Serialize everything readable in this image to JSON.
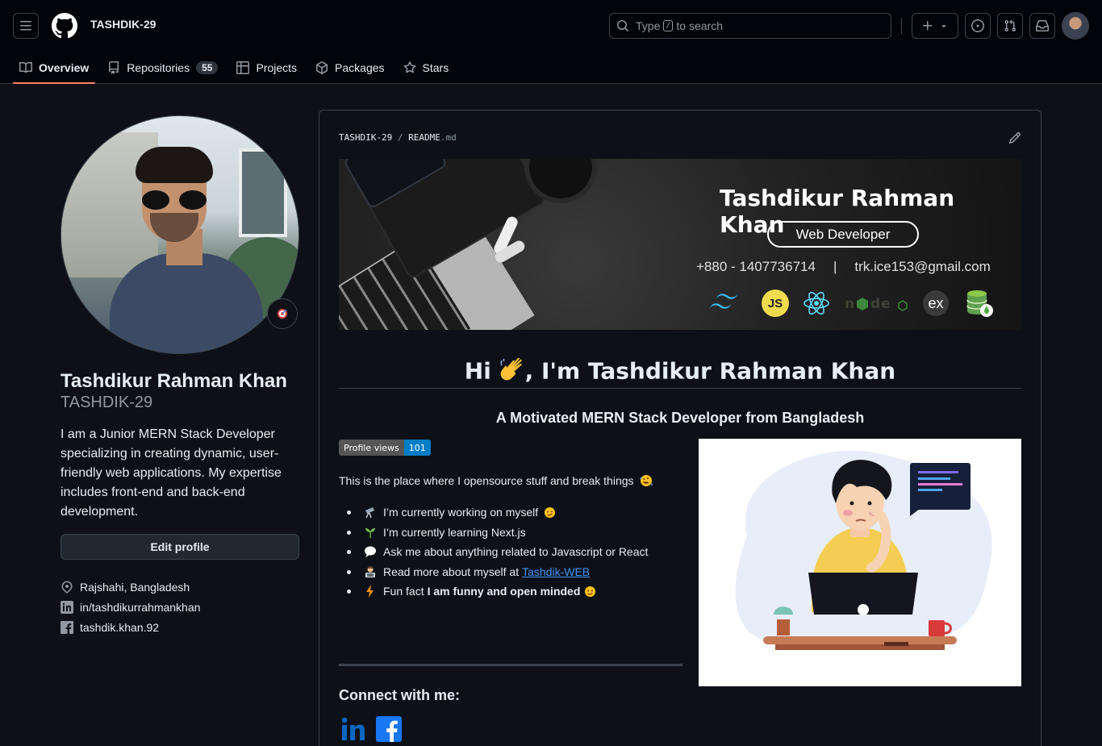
{
  "header": {
    "username": "TASHDIK-29",
    "search": {
      "prefix": "Type",
      "key": "/",
      "suffix": "to search"
    }
  },
  "nav": {
    "tabs": [
      {
        "label": "Overview",
        "icon": "book-icon",
        "active": true
      },
      {
        "label": "Repositories",
        "icon": "repo-icon",
        "count": "55"
      },
      {
        "label": "Projects",
        "icon": "table-icon"
      },
      {
        "label": "Packages",
        "icon": "package-icon"
      },
      {
        "label": "Stars",
        "icon": "star-icon"
      }
    ]
  },
  "profile": {
    "name": "Tashdikur Rahman Khan",
    "login": "TASHDIK-29",
    "bio": "I am a Junior MERN Stack Developer specializing in creating dynamic, user-friendly web applications. My expertise includes front-end and back-end development.",
    "edit_label": "Edit profile",
    "location": "Rajshahi, Bangladesh",
    "linkedin": "in/tashdikurrahmankhan",
    "facebook": "tashdik.khan.92"
  },
  "readme": {
    "owner": "TASHDIK-29",
    "file": "README",
    "ext": ".md",
    "banner": {
      "name": "Tashdikur Rahman Khan",
      "role": "Web Developer",
      "phone": "+880 - 1407736714",
      "separator": "|",
      "email": "trk.ice153@gmail.com",
      "tech_icons": [
        "tailwind-icon",
        "javascript-icon",
        "react-icon",
        "nodejs-icon",
        "express-icon",
        "mongodb-icon"
      ],
      "js_label": "JS",
      "ex_label": "ex"
    },
    "heading_pre": "Hi",
    "heading_post": ", I'm Tashdikur Rahman Khan",
    "subtitle": "A Motivated MERN Stack Developer from Bangladesh",
    "badge": {
      "label": "Profile views",
      "value": "101"
    },
    "intro": "This is the place where I opensource stuff and break things",
    "items": {
      "working": "I’m currently working on myself",
      "learning": "I’m currently learning Next.js",
      "ask": "Ask me about anything related to Javascript or React",
      "read_pre": "Read more about myself at",
      "read_link": "Tashdik-WEB",
      "fun_pre": "Fun fact",
      "fun_bold": "I am funny and open minded"
    },
    "connect": "Connect with me:"
  },
  "colors": {
    "bg": "#0d1117",
    "header_bg": "#010409",
    "accent_underline": "#f78166",
    "link": "#4493f8",
    "badge_blue": "#007ec6"
  }
}
